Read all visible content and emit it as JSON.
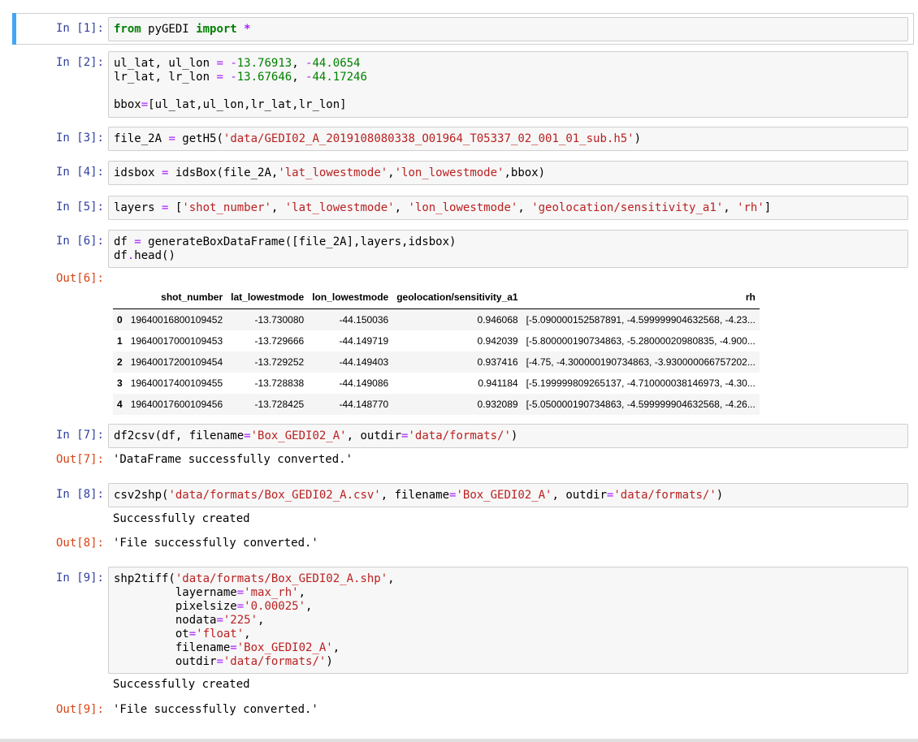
{
  "cells": {
    "c1": {
      "prompt": "In [1]:"
    },
    "c2": {
      "prompt": "In [2]:"
    },
    "c3": {
      "prompt": "In [3]:"
    },
    "c4": {
      "prompt": "In [4]:"
    },
    "c5": {
      "prompt": "In [5]:"
    },
    "c6": {
      "prompt": "In [6]:",
      "out_prompt": "Out[6]:"
    },
    "c7": {
      "prompt": "In [7]:",
      "out_prompt": "Out[7]:",
      "output": "'DataFrame successfully converted.'"
    },
    "c8": {
      "prompt": "In [8]:",
      "stdout": "Successfully created",
      "out_prompt": "Out[8]:",
      "output": "'File successfully converted.'"
    },
    "c9": {
      "prompt": "In [9]:",
      "stdout": "Successfully created",
      "out_prompt": "Out[9]:",
      "output": "'File successfully converted.'"
    }
  },
  "dataframe": {
    "columns": [
      "",
      "shot_number",
      "lat_lowestmode",
      "lon_lowestmode",
      "geolocation/sensitivity_a1",
      "rh"
    ],
    "rows": [
      [
        "0",
        "19640016800109452",
        "-13.730080",
        "-44.150036",
        "0.946068",
        "[-5.090000152587891, -4.599999904632568, -4.23..."
      ],
      [
        "1",
        "19640017000109453",
        "-13.729666",
        "-44.149719",
        "0.942039",
        "[-5.800000190734863, -5.28000020980835, -4.900..."
      ],
      [
        "2",
        "19640017200109454",
        "-13.729252",
        "-44.149403",
        "0.937416",
        "[-4.75, -4.300000190734863, -3.930000066757202..."
      ],
      [
        "3",
        "19640017400109455",
        "-13.728838",
        "-44.149086",
        "0.941184",
        "[-5.199999809265137, -4.710000038146973, -4.30..."
      ],
      [
        "4",
        "19640017600109456",
        "-13.728425",
        "-44.148770",
        "0.932089",
        "[-5.050000190734863, -4.599999904632568, -4.26..."
      ]
    ]
  }
}
